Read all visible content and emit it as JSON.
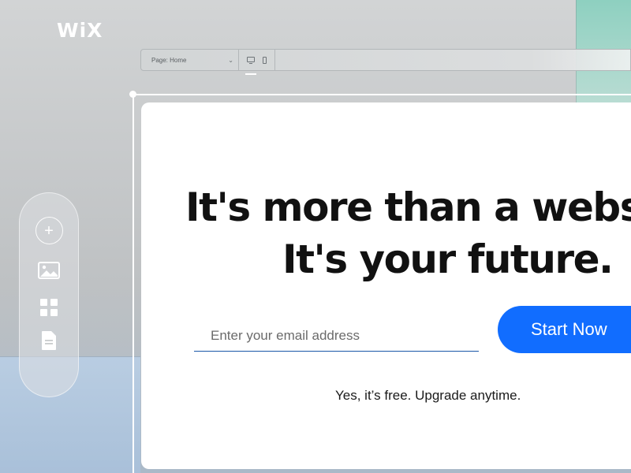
{
  "brand": {
    "logo_text": "WiX"
  },
  "editor": {
    "page_select_label": "Page: Home",
    "devices": [
      "desktop-icon",
      "mobile-icon"
    ]
  },
  "side_toolbar": {
    "items": [
      "add-icon",
      "media-icon",
      "apps-icon",
      "pages-icon"
    ]
  },
  "hero": {
    "headline_line1": "It's more than a webs",
    "headline_line2": "It's your future.",
    "email_placeholder": "Enter your email address",
    "cta_label": "Start Now",
    "note": "Yes, it’s free. Upgrade anytime."
  },
  "colors": {
    "accent": "#116dff",
    "input_underline": "#1a57a8"
  }
}
